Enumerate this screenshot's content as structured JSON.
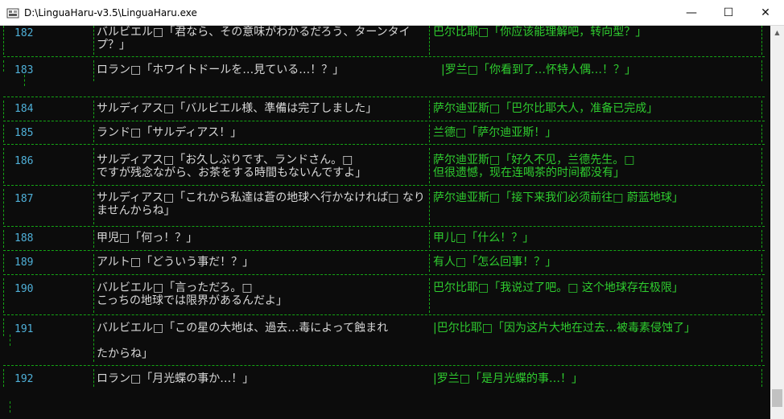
{
  "window": {
    "title": "D:\\LinguaHaru-v3.5\\LinguaHaru.exe",
    "minimize_label": "—",
    "maximize_label": "☐",
    "close_label": "✕"
  },
  "rows": [
    {
      "num": "182",
      "jp": "バルビエル□「君なら、その意味がわかるだろう、ターンタイプ？」",
      "zh": "巴尔比耶□「你应该能理解吧，转向型？」"
    },
    {
      "num": "183",
      "jp": "ロラン□「ホワイトドールを…見ている…！？」",
      "zh": "|罗兰□「你看到了…怀特人偶…！？」"
    },
    {
      "num": "184",
      "jp": "サルディアス□「バルビエル様、準備は完了しました」",
      "zh": "萨尔迪亚斯□「巴尔比耶大人，准备已完成」"
    },
    {
      "num": "185",
      "jp": "ランド□「サルディアス！」",
      "zh": "兰德□「萨尔迪亚斯！」"
    },
    {
      "num": "186",
      "jp": "サルディアス□「お久しぶりです、ランドさん。□\nですが残念ながら、お茶をする時間もないんですよ」",
      "zh": "萨尔迪亚斯□「好久不见，兰德先生。□\n但很遗憾，现在连喝茶的时间都没有」"
    },
    {
      "num": "187",
      "jp": "サルディアス□「これから私達は蒼の地球へ行かなければ□ なりませんからね」",
      "zh": "萨尔迪亚斯□「接下来我们必须前往□ 蔚蓝地球」"
    },
    {
      "num": "188",
      "jp": "甲児□「何っ！？」",
      "zh": "甲儿□「什么！？」"
    },
    {
      "num": "189",
      "jp": "アルト□「どういう事だ！？」",
      "zh": "有人□「怎么回事！？」"
    },
    {
      "num": "190",
      "jp": "バルビエル□「言っただろ。□\nこっちの地球では限界があるんだよ」",
      "zh": "巴尔比耶□「我说过了吧。□ 这个地球存在极限」"
    },
    {
      "num": "191",
      "jp": "バルビエル□「この星の大地は、過去…毒によって蝕まれ\n\nたからね」",
      "zh": "|巴尔比耶□「因为这片大地在过去…被毒素侵蚀了」"
    },
    {
      "num": "192",
      "jp": "ロラン□「月光蝶の事か…！」",
      "zh": "|罗兰□「是月光蝶的事…！」"
    }
  ]
}
